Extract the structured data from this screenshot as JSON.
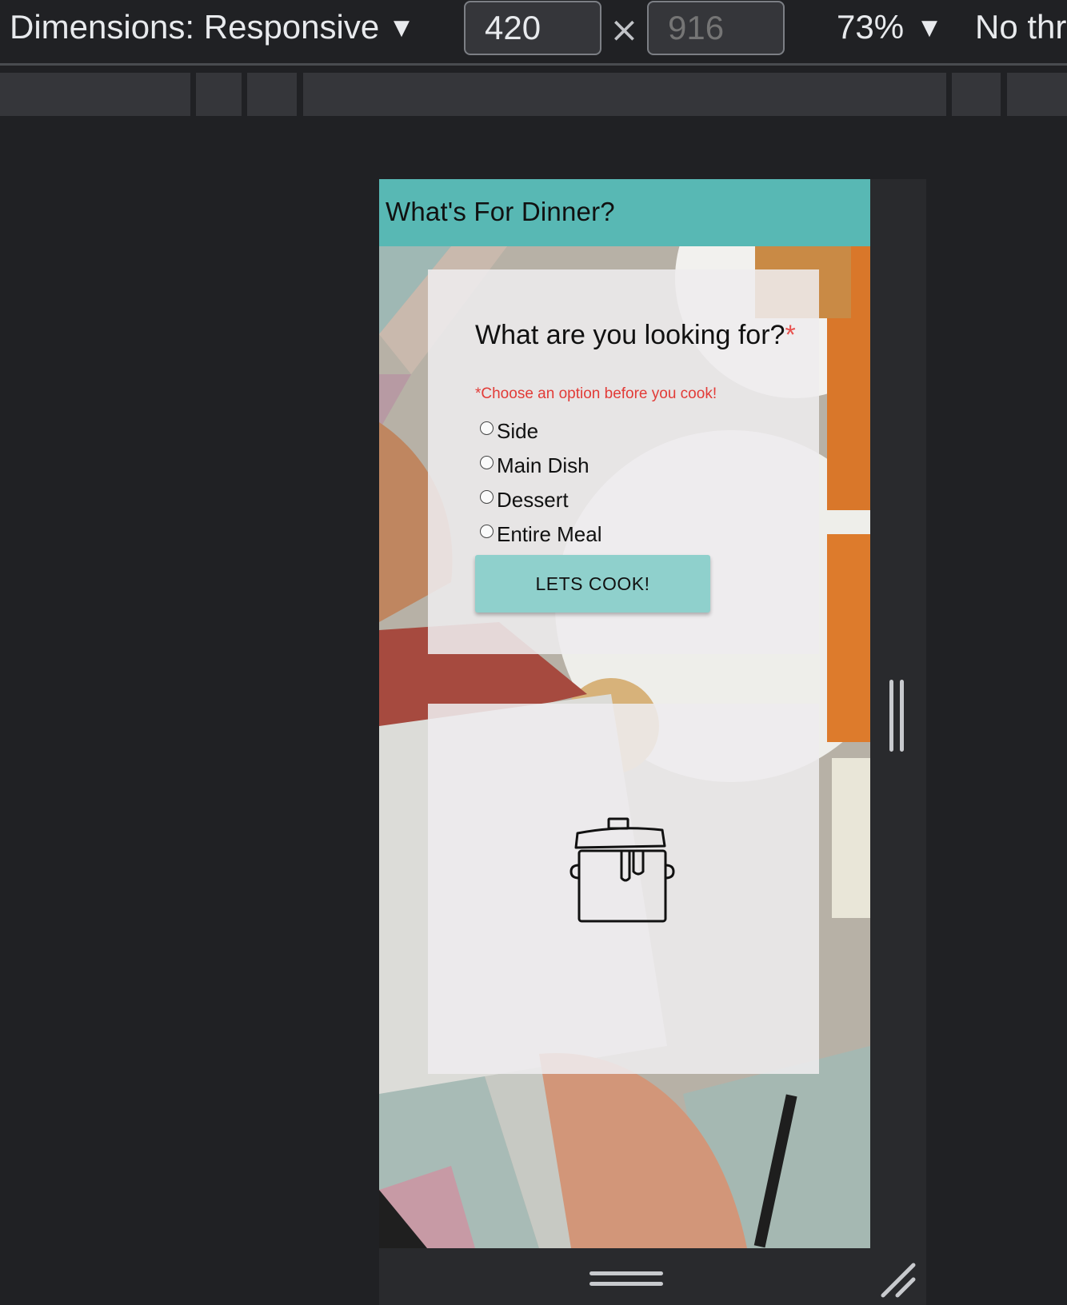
{
  "devtools": {
    "dimensions_label": "Dimensions: Responsive",
    "width_value": "420",
    "height_placeholder": "916",
    "times_symbol": "×",
    "zoom_label": "73%",
    "throttle_label": "No thr",
    "caret": "▼"
  },
  "page": {
    "title": "What's For Dinner?",
    "header_color": "#58b8b4",
    "form": {
      "question": "What are you looking for?",
      "required_mark": "*",
      "hint": "*Choose an option before you cook!",
      "options": [
        {
          "label": "Side",
          "checked": false
        },
        {
          "label": "Main Dish",
          "checked": false
        },
        {
          "label": "Dessert",
          "checked": false
        },
        {
          "label": "Entire Meal",
          "checked": false
        }
      ],
      "submit_label": "LETS COOK!",
      "button_color": "#8fd0cc"
    },
    "result": {
      "icon": "cooking-pot-icon"
    }
  }
}
